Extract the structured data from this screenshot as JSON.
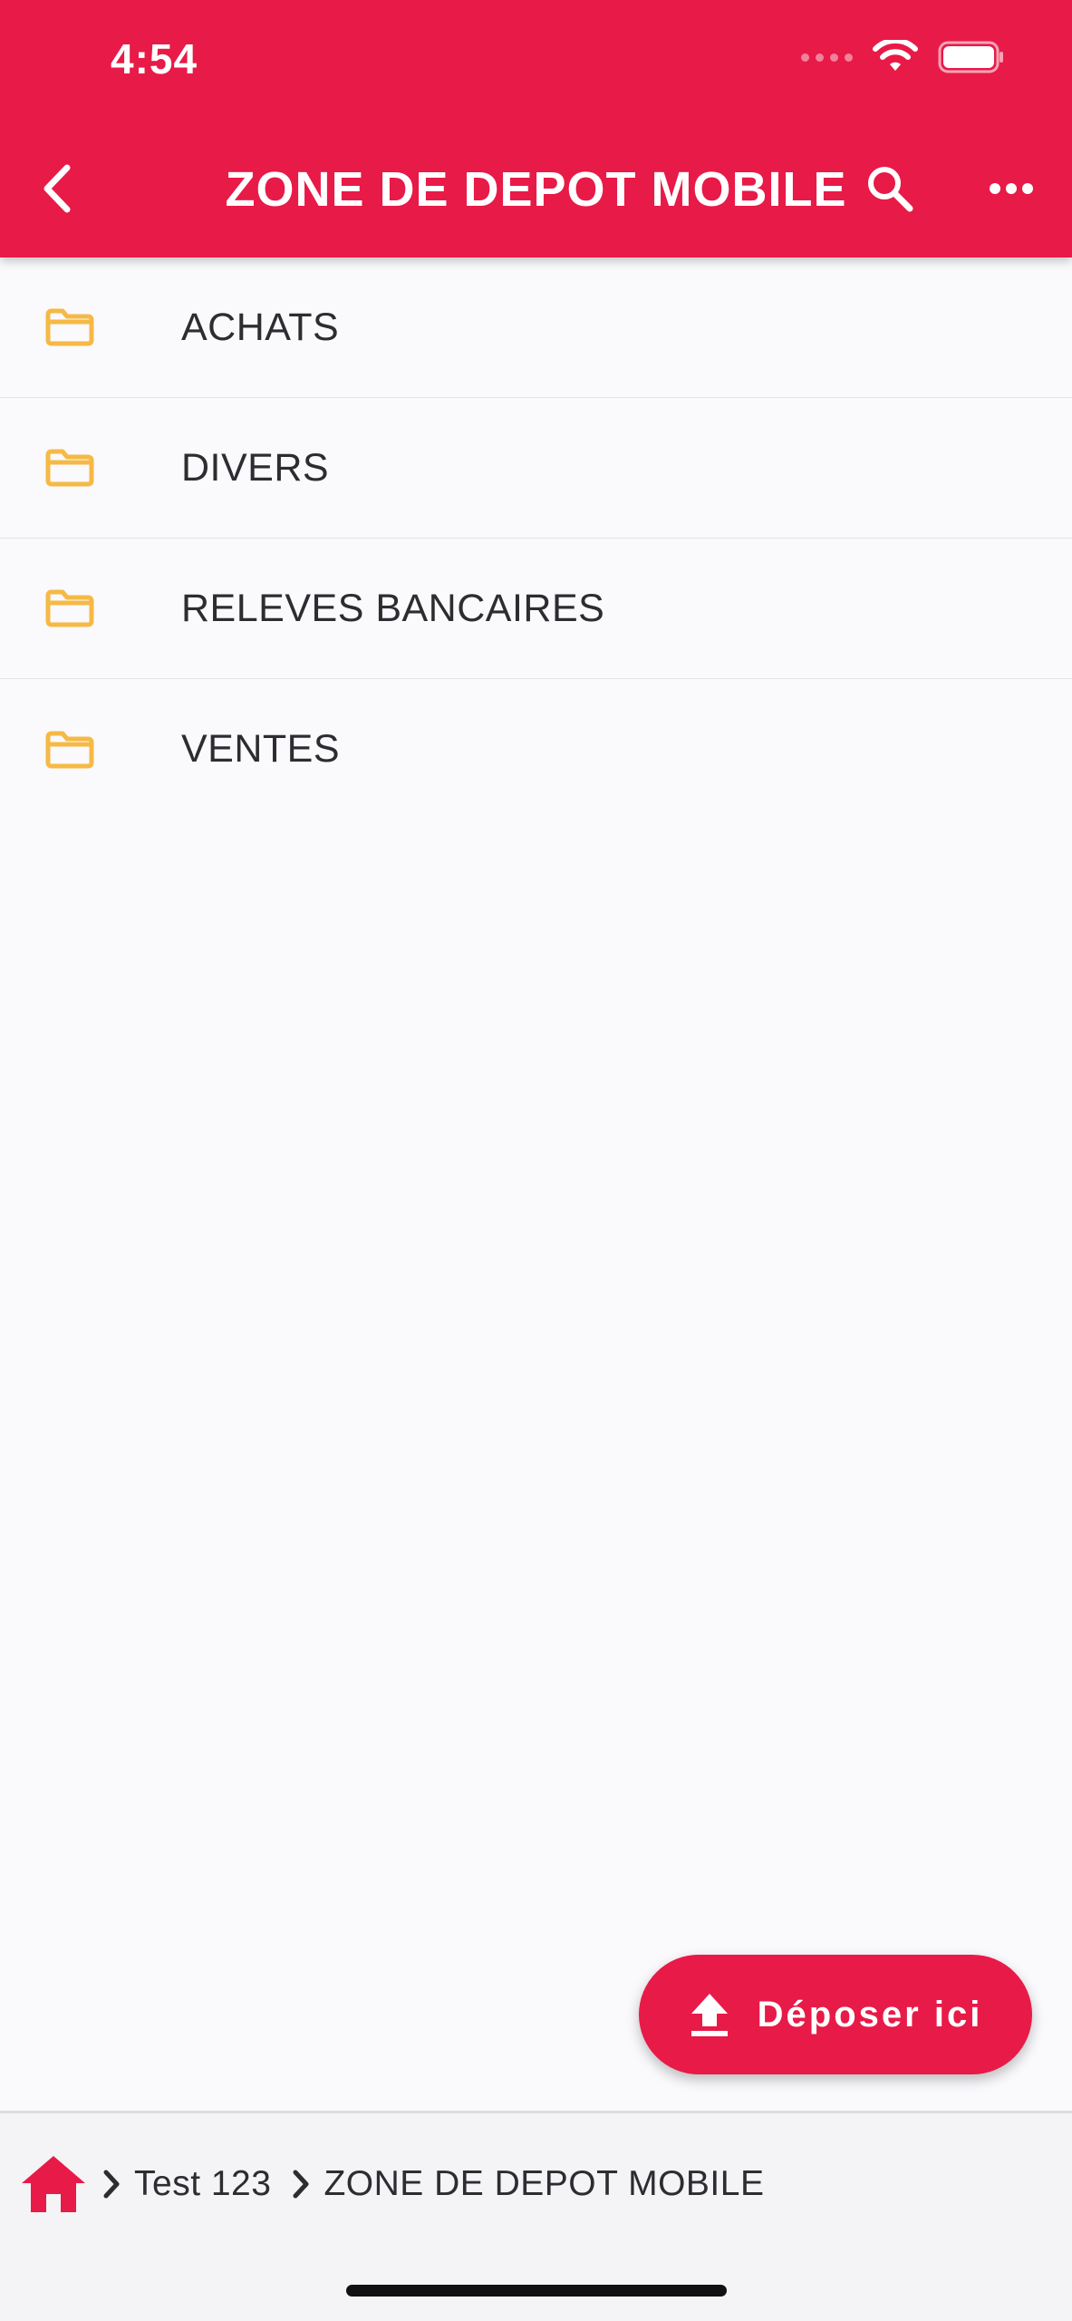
{
  "status_bar": {
    "time": "4:54",
    "icons": [
      "cellular-signal-icon",
      "wifi-icon",
      "battery-icon"
    ]
  },
  "header": {
    "title": "ZONE DE DEPOT MOBILE",
    "icons": {
      "back": "chevron-left-icon",
      "search": "search-icon",
      "more": "more-horizontal-icon"
    }
  },
  "folders": [
    {
      "label": "ACHATS",
      "icon": "folder-icon"
    },
    {
      "label": "DIVERS",
      "icon": "folder-icon"
    },
    {
      "label": "RELEVES BANCAIRES",
      "icon": "folder-icon"
    },
    {
      "label": "VENTES",
      "icon": "folder-icon"
    }
  ],
  "fab": {
    "label": "Déposer ici",
    "icon": "upload-icon"
  },
  "breadcrumb": {
    "home_icon": "home-icon",
    "items": [
      "Test 123",
      "ZONE DE DEPOT MOBILE"
    ]
  },
  "colors": {
    "accent": "#e81a48",
    "folder": "#f5b945",
    "background": "#faf9fc",
    "text": "#2d2d31",
    "breadcrumb_bg": "#f4f3f6"
  }
}
